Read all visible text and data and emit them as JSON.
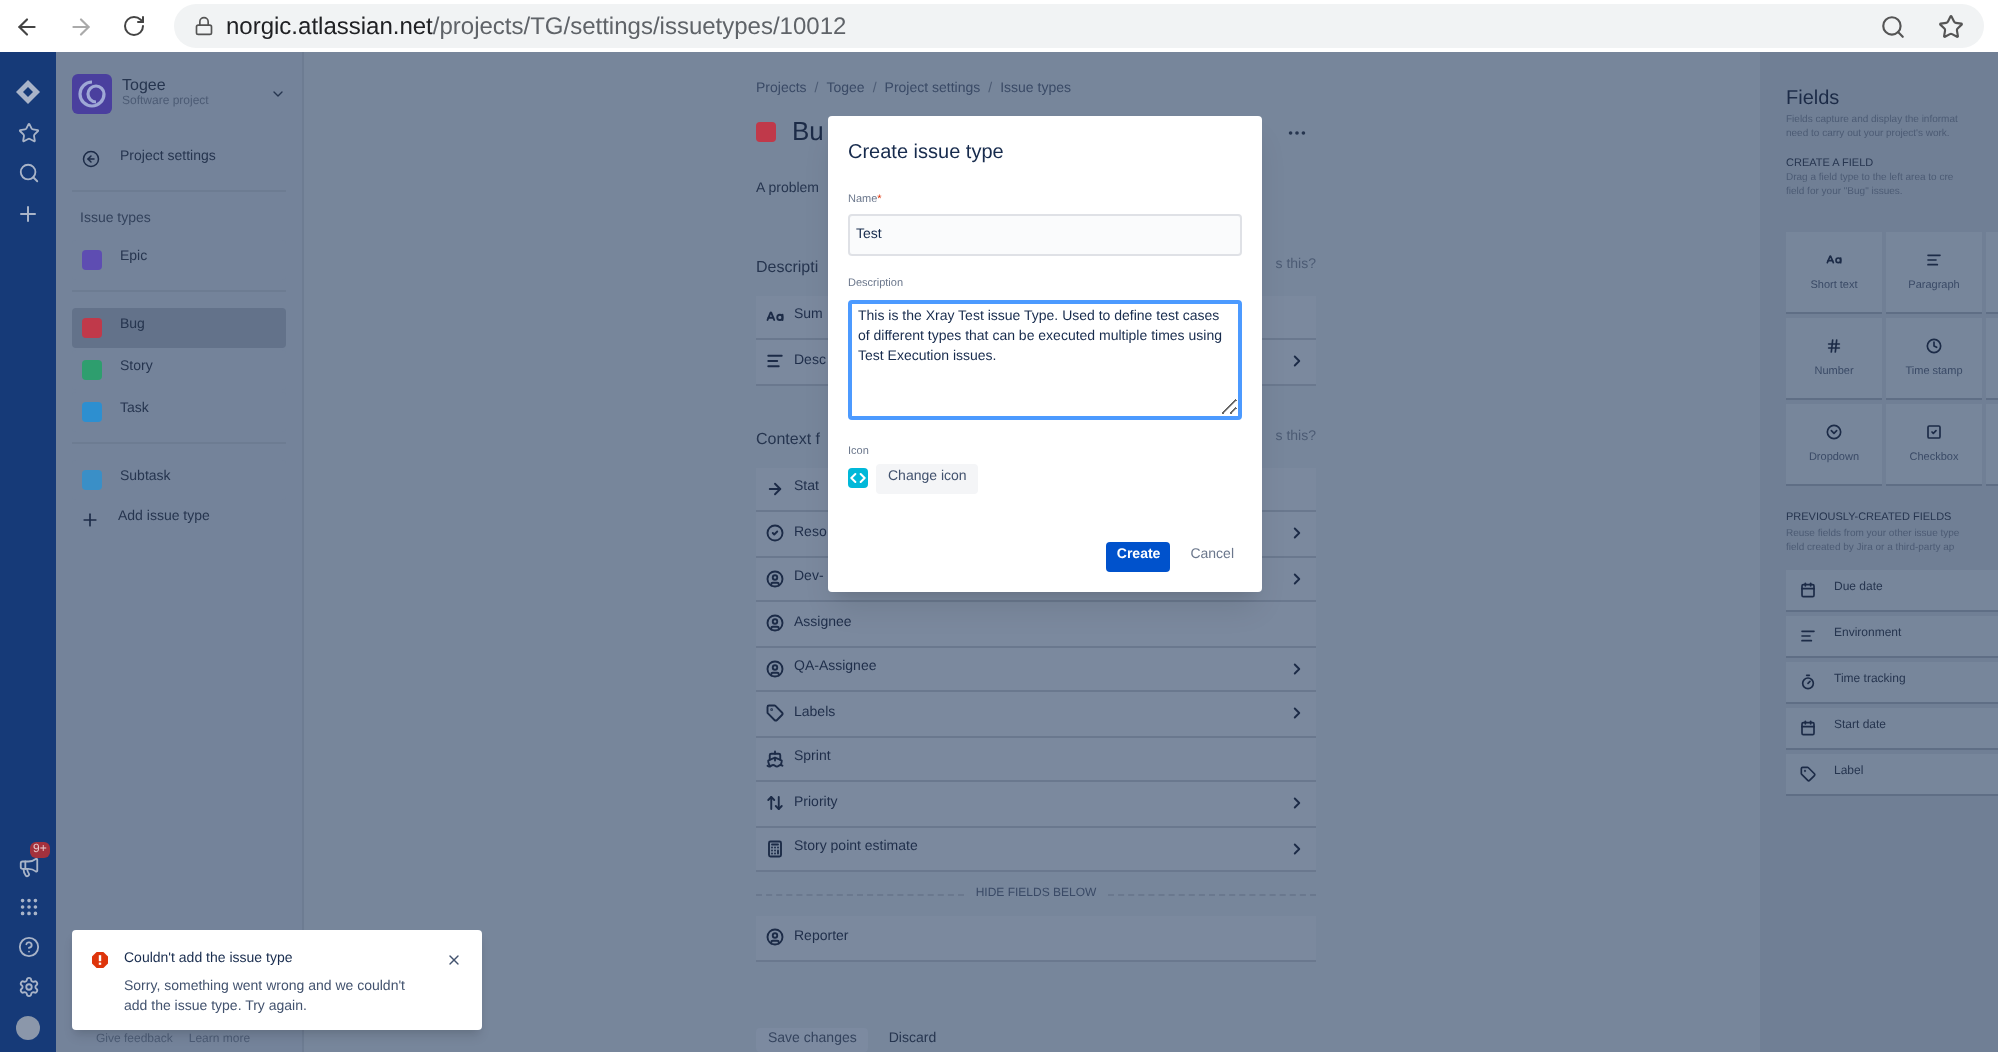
{
  "browser": {
    "host": "norgic.atlassian.net",
    "path": "/projects/TG/settings/issuetypes/10012"
  },
  "nav_rail": {
    "notification_badge": "9+"
  },
  "project": {
    "name": "Togee",
    "type": "Software project"
  },
  "sidebar": {
    "back_link": "Project settings",
    "section_title": "Issue types",
    "groups": [
      {
        "items": [
          {
            "label": "Epic",
            "color": "#5e4db2",
            "selected": false
          }
        ]
      },
      {
        "items": [
          {
            "label": "Bug",
            "color": "#c0394a",
            "selected": true
          },
          {
            "label": "Story",
            "color": "#2e9e6e",
            "selected": false
          },
          {
            "label": "Task",
            "color": "#2d8fd0",
            "selected": false
          }
        ]
      },
      {
        "items": [
          {
            "label": "Subtask",
            "color": "#3a8fc7",
            "selected": false
          }
        ]
      }
    ],
    "add_link": "Add issue type"
  },
  "footer_links": [
    "Give feedback",
    "Learn more"
  ],
  "breadcrumbs": {
    "separator": "/",
    "items": [
      "Projects",
      "Togee",
      "Project settings",
      "Issue types"
    ]
  },
  "title": {
    "text": "Bu",
    "color": "#c0394a"
  },
  "description": "A problem",
  "sections": [
    {
      "title": "Descripti",
      "aside": "s this?",
      "fields": [
        {
          "label": "Sum",
          "chevron": false
        },
        {
          "label": "Desc",
          "chevron": true
        }
      ]
    },
    {
      "title": "Context f",
      "aside": "s this?",
      "fields": [
        {
          "label": "Stat",
          "chevron": false
        },
        {
          "label": "Reso",
          "chevron": true
        },
        {
          "label": "Dev-",
          "chevron": true
        },
        {
          "label": "Assignee",
          "chevron": false
        },
        {
          "label": "QA-Assignee",
          "chevron": true
        },
        {
          "label": "Labels",
          "chevron": true
        },
        {
          "label": "Sprint",
          "chevron": false
        },
        {
          "label": "Priority",
          "chevron": true
        },
        {
          "label": "Story point estimate",
          "chevron": true
        }
      ]
    }
  ],
  "hidden_divider": "HIDE FIELDS BELOW",
  "hidden_fields": [
    {
      "label": "Reporter",
      "chevron": false
    }
  ],
  "actions": {
    "save": {
      "label": "Save changes",
      "disabled": true
    },
    "discard": "Discard"
  },
  "fields_panel": {
    "title": "Fields",
    "intro": [
      "Fields capture and display the informat",
      "need to carry out your project's work."
    ],
    "create_title": "CREATE A FIELD",
    "create_hint": [
      "Drag a field type to the left area to cre",
      "field for your \"Bug\" issues."
    ],
    "field_types": [
      "Short text",
      "Paragraph",
      "Number",
      "Time stamp",
      "Dropdown",
      "Checkbox"
    ],
    "previous_title": "PREVIOUSLY-CREATED FIELDS",
    "previous_hint": [
      "Reuse fields from your other issue type",
      "field created by Jira or a third-party ap"
    ],
    "previous_fields": [
      "Due date",
      "Environment",
      "Time tracking",
      "Start date",
      "Label"
    ]
  },
  "modal": {
    "title": "Create issue type",
    "name_label": "Name",
    "required_mark": "*",
    "name_value": "Test",
    "description_label": "Description",
    "description_value": "This is the Xray Test issue Type. Used to define test cases of different types that can be executed multiple times using Test Execution issues.",
    "icon_label": "Icon",
    "change_icon": "Change icon",
    "create": "Create",
    "cancel": "Cancel"
  },
  "toast": {
    "title": "Couldn't add the issue type",
    "body": "Sorry, something went wrong and we couldn't add the issue type. Try again."
  }
}
